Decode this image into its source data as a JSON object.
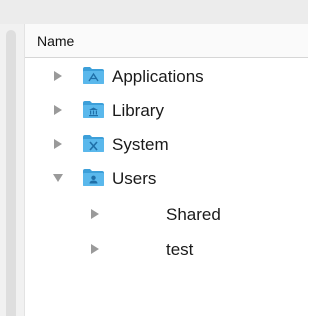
{
  "header": {
    "name_column_label": "Name"
  },
  "rows": [
    {
      "label": "Applications",
      "expanded": false,
      "icon": "applications-folder-icon"
    },
    {
      "label": "Library",
      "expanded": false,
      "icon": "library-folder-icon"
    },
    {
      "label": "System",
      "expanded": false,
      "icon": "system-folder-icon"
    },
    {
      "label": "Users",
      "expanded": true,
      "icon": "users-folder-icon"
    },
    {
      "label": "Shared",
      "expanded": false,
      "icon": "none"
    },
    {
      "label": "test",
      "expanded": false,
      "icon": "none"
    }
  ],
  "colors": {
    "folder": "#5ab8ec",
    "folder_dark": "#3c9fd9",
    "disclosure": "#9a9a9a"
  }
}
